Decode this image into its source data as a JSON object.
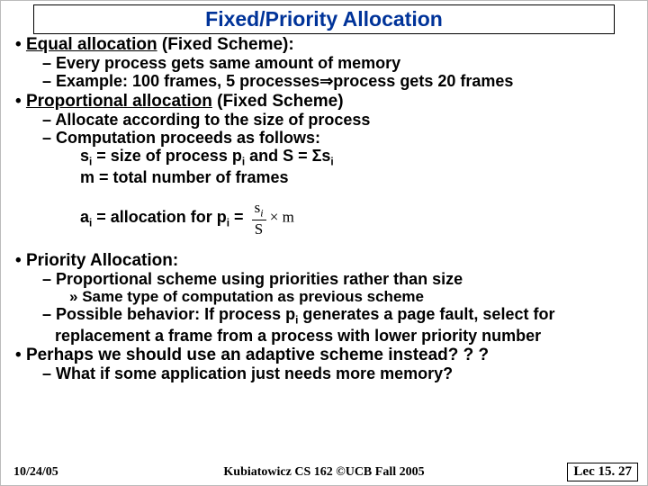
{
  "title": "Fixed/Priority Allocation",
  "b1a_label": "Equal allocation",
  "b1a_rest": " (Fixed Scheme):",
  "b1a_s1": "Every process gets same amount of memory",
  "b1a_s2": "Example: 100 frames, 5 processes⇒process gets 20 frames",
  "b1b_label": "Proportional allocation",
  "b1b_rest": " (Fixed Scheme)",
  "b1b_s1": "Allocate according to the size of process",
  "b1b_s2": "Computation proceeds as follows:",
  "comp_line1_a": "s",
  "comp_line1_b": " = size of process p",
  "comp_line1_c": " and S = Σs",
  "comp_line2": "m = total number of frames",
  "comp_line3_a": "a",
  "comp_line3_b": " = allocation for p",
  "comp_line3_c": " = ",
  "frac_num_a": "s",
  "frac_num_i": "i",
  "frac_den": "S",
  "frac_mult": " × m",
  "b1c": "Priority Allocation:",
  "b1c_s1": "Proportional scheme using priorities rather than size",
  "b1c_s1a": "Same type of computation as previous scheme",
  "b1c_s2_a": "Possible behavior: If process p",
  "b1c_s2_b": " generates a page fault, select for replacement a frame from a process with lower priority number",
  "b1d": "Perhaps we should use an adaptive scheme instead? ? ?",
  "b1d_s1": "What if some application just needs more memory?",
  "footer": {
    "date": "10/24/05",
    "course": "Kubiatowicz CS 162 ©UCB Fall 2005",
    "lec": "Lec 15. 27"
  },
  "sub_i": "i"
}
